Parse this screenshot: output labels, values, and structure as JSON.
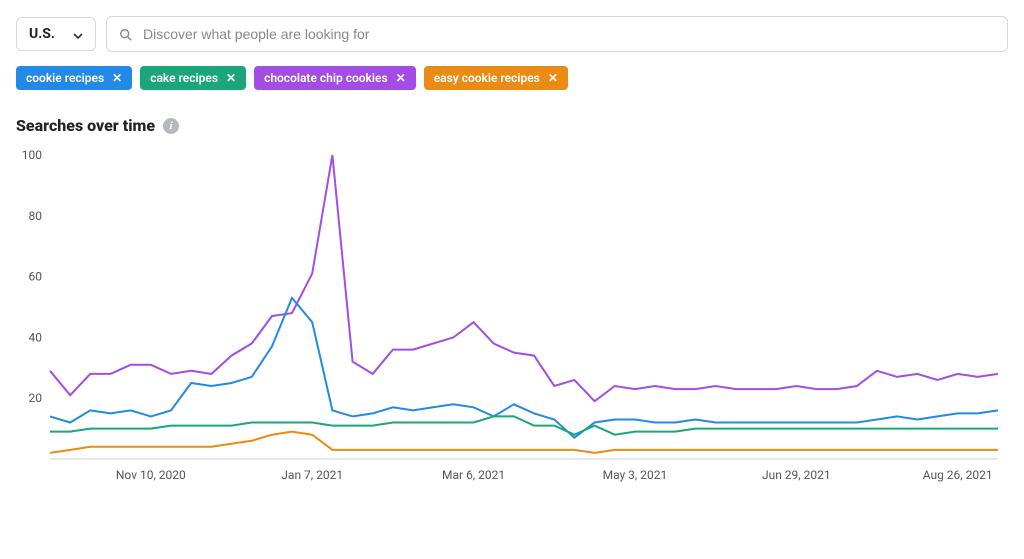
{
  "header": {
    "country_label": "U.S.",
    "search_placeholder": "Discover what people are looking for"
  },
  "chips": [
    {
      "label": "cookie recipes",
      "color": "#2389e6"
    },
    {
      "label": "cake recipes",
      "color": "#1aa679"
    },
    {
      "label": "chocolate chip cookies",
      "color": "#a24de3"
    },
    {
      "label": "easy cookie recipes",
      "color": "#ea8b13"
    }
  ],
  "section": {
    "title": "Searches over time"
  },
  "chart_data": {
    "type": "line",
    "title": "Searches over time",
    "xlabel": "",
    "ylabel": "",
    "ylim": [
      0,
      100
    ],
    "y_ticks": [
      20,
      40,
      60,
      80,
      100
    ],
    "x_tick_labels": [
      "Nov 10, 2020",
      "Jan 7, 2021",
      "Mar 6, 2021",
      "May 3, 2021",
      "Jun 29, 2021",
      "Aug 26, 2021"
    ],
    "x_tick_positions": [
      5,
      13,
      21,
      29,
      37,
      45
    ],
    "x": [
      0,
      1,
      2,
      3,
      4,
      5,
      6,
      7,
      8,
      9,
      10,
      11,
      12,
      13,
      14,
      15,
      16,
      17,
      18,
      19,
      20,
      21,
      22,
      23,
      24,
      25,
      26,
      27,
      28,
      29,
      30,
      31,
      32,
      33,
      34,
      35,
      36,
      37,
      38,
      39,
      40,
      41,
      42,
      43,
      44,
      45,
      46,
      47
    ],
    "series": [
      {
        "name": "chocolate chip cookies",
        "color": "#a24de3",
        "values": [
          29,
          21,
          28,
          28,
          31,
          31,
          28,
          29,
          28,
          34,
          38,
          47,
          48,
          61,
          100,
          32,
          28,
          36,
          36,
          38,
          40,
          45,
          38,
          35,
          34,
          24,
          26,
          19,
          24,
          23,
          24,
          23,
          23,
          24,
          23,
          23,
          23,
          24,
          23,
          23,
          24,
          29,
          27,
          28,
          26,
          28,
          27,
          28
        ]
      },
      {
        "name": "cookie recipes",
        "color": "#2389e6",
        "values": [
          14,
          12,
          16,
          15,
          16,
          14,
          16,
          25,
          24,
          25,
          27,
          37,
          53,
          45,
          16,
          14,
          15,
          17,
          16,
          17,
          18,
          17,
          14,
          18,
          15,
          13,
          7,
          12,
          13,
          13,
          12,
          12,
          13,
          12,
          12,
          12,
          12,
          12,
          12,
          12,
          12,
          13,
          14,
          13,
          14,
          15,
          15,
          16
        ]
      },
      {
        "name": "cake recipes",
        "color": "#1aa679",
        "values": [
          9,
          9,
          10,
          10,
          10,
          10,
          11,
          11,
          11,
          11,
          12,
          12,
          12,
          12,
          11,
          11,
          11,
          12,
          12,
          12,
          12,
          12,
          14,
          14,
          11,
          11,
          8,
          11,
          8,
          9,
          9,
          9,
          10,
          10,
          10,
          10,
          10,
          10,
          10,
          10,
          10,
          10,
          10,
          10,
          10,
          10,
          10,
          10
        ]
      },
      {
        "name": "easy cookie recipes",
        "color": "#ea8b13",
        "values": [
          2,
          3,
          4,
          4,
          4,
          4,
          4,
          4,
          4,
          5,
          6,
          8,
          9,
          8,
          3,
          3,
          3,
          3,
          3,
          3,
          3,
          3,
          3,
          3,
          3,
          3,
          3,
          2,
          3,
          3,
          3,
          3,
          3,
          3,
          3,
          3,
          3,
          3,
          3,
          3,
          3,
          3,
          3,
          3,
          3,
          3,
          3,
          3
        ]
      }
    ]
  }
}
